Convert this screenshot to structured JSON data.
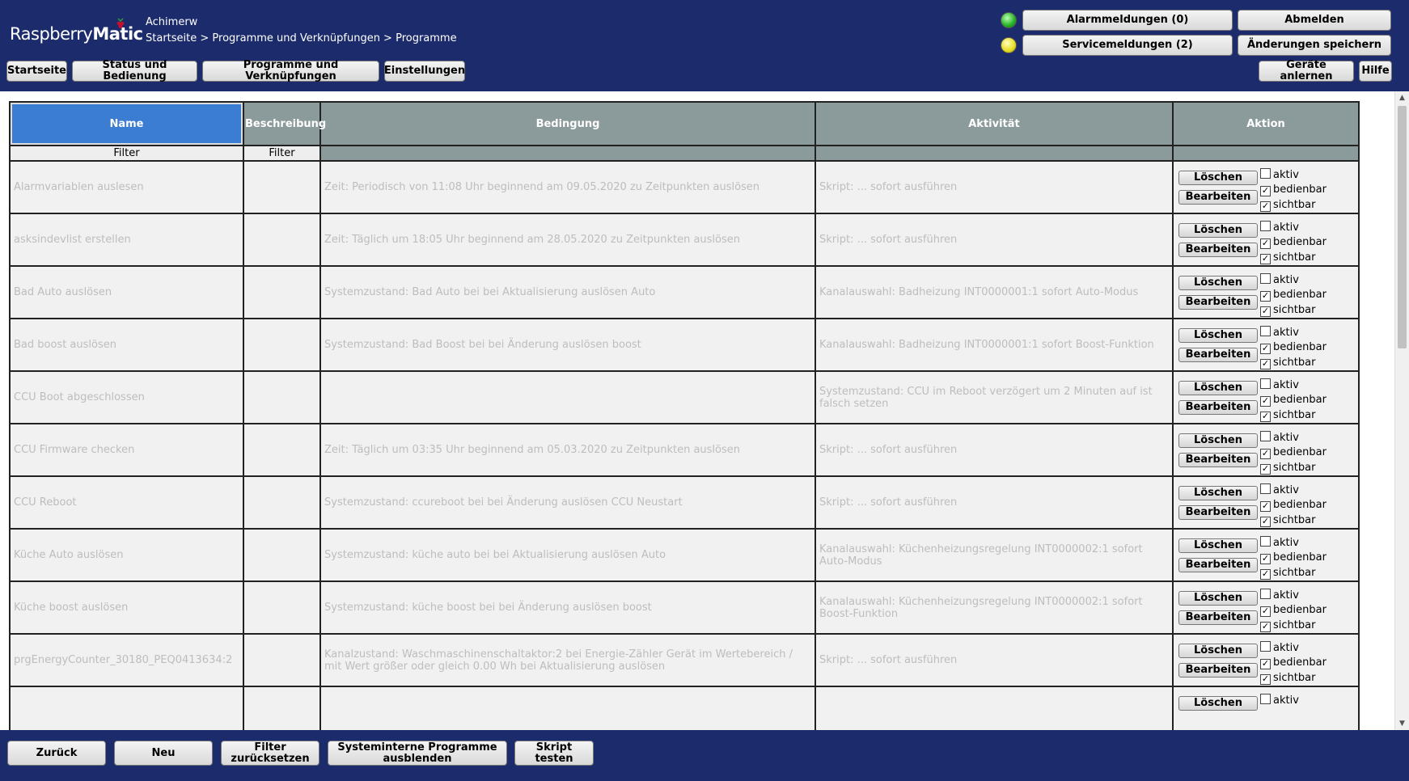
{
  "header": {
    "logo_text_light": "Raspberry",
    "logo_text_bold": "Matic",
    "user": "Achimerw",
    "breadcrumb": "Startseite > Programme und Verknüpfungen > Programme",
    "alarm_button": "Alarmmeldungen (0)",
    "service_button": "Servicemeldungen (2)",
    "logout_button": "Abmelden",
    "save_button": "Änderungen speichern",
    "nav": [
      "Startseite",
      "Status und Bedienung",
      "Programme und Verknüpfungen",
      "Einstellungen"
    ],
    "learn_button": "Geräte anlernen",
    "help_button": "Hilfe",
    "led_colors": {
      "alarm": "#22b022",
      "service": "#e6dc1e"
    }
  },
  "table": {
    "columns": [
      "Name",
      "Beschreibung",
      "Bedingung",
      "Aktivität",
      "Aktion"
    ],
    "filter_label": "Filter",
    "delete_label": "Löschen",
    "edit_label": "Bearbeiten",
    "check_labels": [
      "aktiv",
      "bedienbar",
      "sichtbar"
    ],
    "rows": [
      {
        "name": "Alarmvariablen auslesen",
        "desc": "",
        "cond": "Zeit: Periodisch von 11:08 Uhr beginnend am 09.05.2020 zu Zeitpunkten auslösen",
        "activity": "Skript: ... sofort ausführen",
        "checks": [
          false,
          true,
          true
        ]
      },
      {
        "name": "asksindevlist erstellen",
        "desc": "",
        "cond": "Zeit: Täglich um 18:05 Uhr beginnend am 28.05.2020 zu Zeitpunkten auslösen",
        "activity": "Skript: ... sofort ausführen",
        "checks": [
          false,
          true,
          true
        ]
      },
      {
        "name": "Bad Auto auslösen",
        "desc": "",
        "cond": "Systemzustand: Bad Auto bei bei Aktualisierung auslösen Auto",
        "activity": "Kanalauswahl: Badheizung INT0000001:1 sofort Auto-Modus",
        "checks": [
          false,
          true,
          true
        ]
      },
      {
        "name": "Bad boost auslösen",
        "desc": "",
        "cond": "Systemzustand: Bad Boost bei bei Änderung auslösen boost",
        "activity": "Kanalauswahl: Badheizung INT0000001:1 sofort Boost-Funktion",
        "checks": [
          false,
          true,
          true
        ]
      },
      {
        "name": "CCU Boot abgeschlossen",
        "desc": "",
        "cond": "",
        "activity": "Systemzustand: CCU im Reboot verzögert um 2 Minuten auf ist falsch setzen",
        "checks": [
          false,
          true,
          true
        ]
      },
      {
        "name": "CCU Firmware checken",
        "desc": "",
        "cond": "Zeit: Täglich um 03:35 Uhr beginnend am 05.03.2020 zu Zeitpunkten auslösen",
        "activity": "Skript: ... sofort ausführen",
        "checks": [
          false,
          true,
          true
        ]
      },
      {
        "name": "CCU Reboot",
        "desc": "",
        "cond": "Systemzustand: ccureboot bei bei Änderung auslösen CCU Neustart",
        "activity": "Skript: ... sofort ausführen",
        "checks": [
          false,
          true,
          true
        ]
      },
      {
        "name": "Küche Auto auslösen",
        "desc": "",
        "cond": "Systemzustand: küche auto bei bei Aktualisierung auslösen Auto",
        "activity": "Kanalauswahl: Küchenheizungsregelung INT0000002:1 sofort Auto-Modus",
        "checks": [
          false,
          true,
          true
        ]
      },
      {
        "name": "Küche boost auslösen",
        "desc": "",
        "cond": "Systemzustand: küche boost bei bei Änderung auslösen boost",
        "activity": "Kanalauswahl: Küchenheizungsregelung INT0000002:1 sofort Boost-Funktion",
        "checks": [
          false,
          true,
          true
        ]
      },
      {
        "name": "prgEnergyCounter_30180_PEQ0413634:2",
        "desc": "",
        "cond": "Kanalzustand: Waschmaschinenschaltaktor:2 bei Energie-Zähler Gerät im Wertebereich / mit Wert größer oder gleich 0.00 Wh bei Aktualisierung auslösen",
        "activity": "Skript: ... sofort ausführen",
        "checks": [
          false,
          true,
          true
        ]
      },
      {
        "name": "",
        "desc": "",
        "cond": "",
        "activity": "",
        "checks": [
          false
        ]
      }
    ]
  },
  "footer": {
    "back": "Zurück",
    "new": "Neu",
    "reset_filter": "Filter zurücksetzen",
    "hide_internal": "Systeminterne Programme ausblenden",
    "test_script": "Skript testen"
  }
}
